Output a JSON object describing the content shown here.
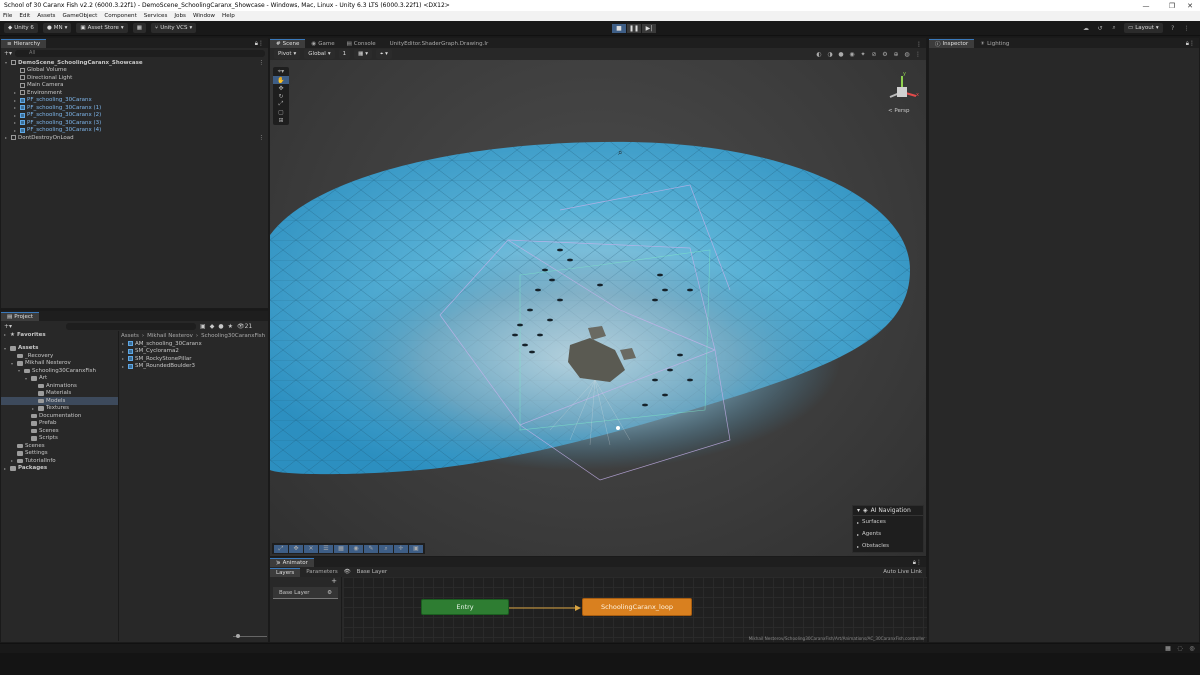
{
  "window": {
    "title": "School of 30 Caranx Fish v2.2 (6000.3.22f1) - DemoScene_SchoolingCaranx_Showcase - Windows, Mac, Linux - Unity 6.3 LTS (6000.3.22f1) <DX12>",
    "minimize": "—",
    "maximize": "❐",
    "close": "✕"
  },
  "menu": [
    "File",
    "Edit",
    "Assets",
    "GameObject",
    "Component",
    "Services",
    "Jobs",
    "Window",
    "Help"
  ],
  "toolbar": {
    "unity": "Unity 6",
    "account": "MN",
    "asset_store": "Asset Store",
    "vcs": "Unity VCS",
    "layout": "Layout"
  },
  "hierarchy": {
    "tab": "Hierarchy",
    "search_placeholder": "All",
    "items": [
      {
        "label": "DemoScene_SchoolingCaranx_Showcase",
        "depth": 0,
        "bold": true,
        "arrow": "▾"
      },
      {
        "label": "Global Volume",
        "depth": 1,
        "arrow": ""
      },
      {
        "label": "Directional Light",
        "depth": 1,
        "arrow": ""
      },
      {
        "label": "Main Camera",
        "depth": 1,
        "arrow": ""
      },
      {
        "label": "Environment",
        "depth": 1,
        "arrow": "▸"
      },
      {
        "label": "PF_schooling_30Caranx",
        "depth": 1,
        "arrow": "▸",
        "blue": true
      },
      {
        "label": "PF_schooling_30Caranx (1)",
        "depth": 1,
        "arrow": "▸",
        "blue": true
      },
      {
        "label": "PF_schooling_30Caranx (2)",
        "depth": 1,
        "arrow": "▸",
        "blue": true
      },
      {
        "label": "PF_schooling_30Caranx (3)",
        "depth": 1,
        "arrow": "▸",
        "blue": true
      },
      {
        "label": "PF_schooling_30Caranx (4)",
        "depth": 1,
        "arrow": "▸",
        "blue": true
      },
      {
        "label": "DontDestroyOnLoad",
        "depth": 0,
        "arrow": "▸"
      }
    ]
  },
  "scene_tabs": [
    "Scene",
    "Game",
    "Console",
    "UnityEditor.ShaderGraph.Drawing.Ir"
  ],
  "scene_toolbar": {
    "pivot": "Pivot",
    "global": "Global",
    "snap": "1"
  },
  "gizmo": {
    "persp": "< Persp",
    "x": "x",
    "y": "y"
  },
  "ai_navigation": {
    "title": "AI Navigation",
    "items": [
      "Surfaces",
      "Agents",
      "Obstacles"
    ]
  },
  "project": {
    "tab": "Project",
    "favorites": "Favorites",
    "count": "21",
    "tree": [
      {
        "label": "Assets",
        "depth": 0,
        "bold": true,
        "arrow": "▾"
      },
      {
        "label": "_Recovery",
        "depth": 1,
        "arrow": ""
      },
      {
        "label": "Mikhail Nesterov",
        "depth": 1,
        "arrow": "▾"
      },
      {
        "label": "Schooling30CaranxFish",
        "depth": 2,
        "arrow": "▾"
      },
      {
        "label": "Art",
        "depth": 3,
        "arrow": "▾"
      },
      {
        "label": "Animations",
        "depth": 4,
        "arrow": ""
      },
      {
        "label": "Materials",
        "depth": 4,
        "arrow": ""
      },
      {
        "label": "Models",
        "depth": 4,
        "arrow": "",
        "selected": true
      },
      {
        "label": "Textures",
        "depth": 4,
        "arrow": "▸"
      },
      {
        "label": "Documentation",
        "depth": 3,
        "arrow": ""
      },
      {
        "label": "Prefab",
        "depth": 3,
        "arrow": ""
      },
      {
        "label": "Scenes",
        "depth": 3,
        "arrow": ""
      },
      {
        "label": "Scripts",
        "depth": 3,
        "arrow": ""
      },
      {
        "label": "Scenes",
        "depth": 1,
        "arrow": ""
      },
      {
        "label": "Settings",
        "depth": 1,
        "arrow": ""
      },
      {
        "label": "TutorialInfo",
        "depth": 1,
        "arrow": "▸"
      },
      {
        "label": "Packages",
        "depth": 0,
        "bold": true,
        "arrow": "▸"
      }
    ],
    "breadcrumb": [
      "Assets",
      "Mikhail Nesterov",
      "Schooling30CaranxFish"
    ],
    "files": [
      "AM_schooling_30Caranx",
      "SM_Cyclorama2",
      "SM_RockyStonePillar",
      "SM_RoundedBoulder3"
    ]
  },
  "inspector": {
    "tabs": [
      "Inspector",
      "Lighting"
    ]
  },
  "animator": {
    "tab": "Animator",
    "layers": "Layers",
    "parameters": "Parameters",
    "base_layer_crumb": "Base Layer",
    "auto_live_link": "Auto Live Link",
    "layer_item": "Base Layer",
    "entry": "Entry",
    "state": "SchoolingCaranx_loop",
    "path": "Mikhail Nesterov/Schooling30CaranxFish/Art/Animations/AC_30CaranxFish.controller"
  },
  "colors": {
    "accent": "#3a79bb",
    "entry": "#2e7d32",
    "state": "#d9801f",
    "water": "#3aa4cf"
  }
}
